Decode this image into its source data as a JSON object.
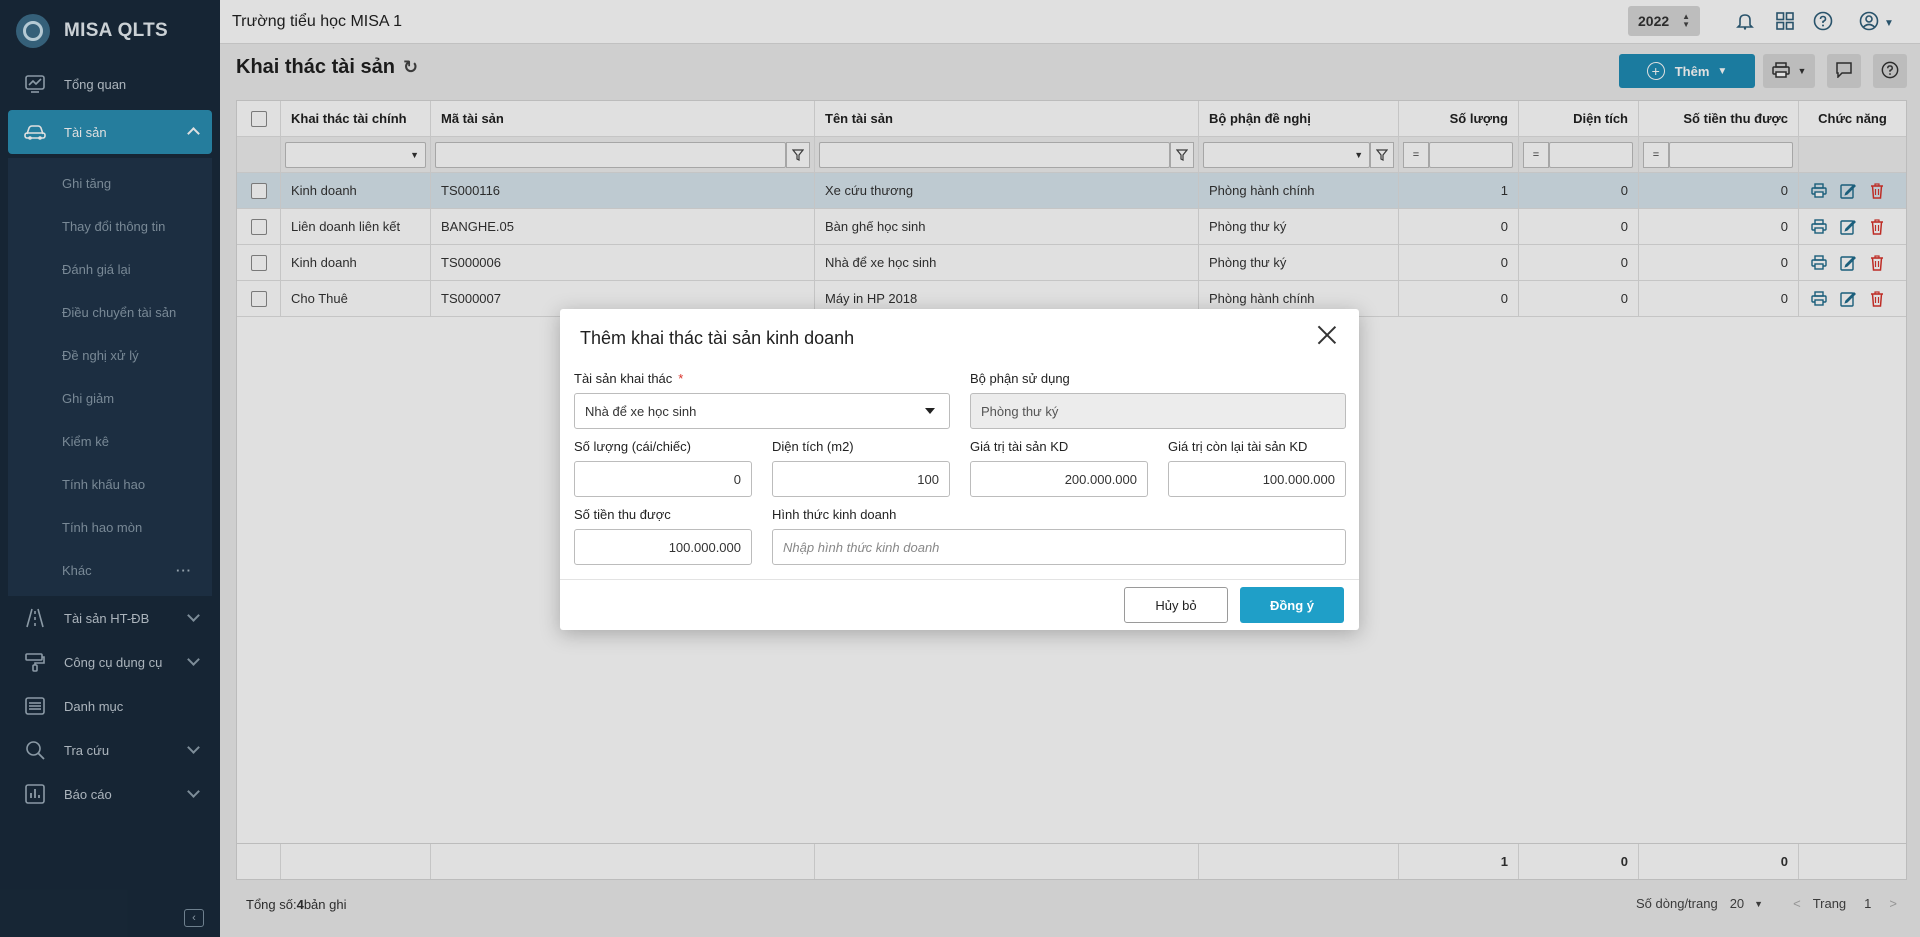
{
  "app": {
    "name": "MISA QLTS"
  },
  "sidebar": {
    "items": [
      {
        "label": "Tổng quan",
        "icon": "dashboard-icon"
      },
      {
        "label": "Tài sản",
        "icon": "car-icon",
        "active": true
      },
      {
        "label": "Tài sản HT-ĐB",
        "icon": "road-icon"
      },
      {
        "label": "Công cụ dụng cụ",
        "icon": "tools-icon"
      },
      {
        "label": "Danh mục",
        "icon": "list-icon"
      },
      {
        "label": "Tra cứu",
        "icon": "search-icon"
      },
      {
        "label": "Báo cáo",
        "icon": "chart-icon"
      }
    ],
    "submenu": [
      "Ghi tăng",
      "Thay đổi thông tin",
      "Đánh giá lại",
      "Điều chuyển tài sản",
      "Đề nghị xử lý",
      "Ghi giảm",
      "Kiểm kê",
      "Tính khấu hao",
      "Tính hao mòn",
      "Khác"
    ],
    "more": "···"
  },
  "topbar": {
    "school": "Trường tiểu học MISA 1",
    "year": "2022"
  },
  "page": {
    "title": "Khai thác tài sản",
    "add_label": "Thêm"
  },
  "grid": {
    "headers": [
      "Khai thác tài chính",
      "Mã tài sản",
      "Tên tài sản",
      "Bộ phận đề nghị",
      "Số lượng",
      "Diện tích",
      "Số tiền thu được",
      "Chức năng"
    ],
    "filter_eq": "=",
    "rows": [
      [
        "Kinh doanh",
        "TS000116",
        "Xe cứu thương",
        "Phòng hành chính",
        "1",
        "0",
        "0"
      ],
      [
        "Liên doanh liên kết",
        "BANGHE.05",
        "Bàn ghế học sinh",
        "Phòng thư ký",
        "0",
        "0",
        "0"
      ],
      [
        "Kinh doanh",
        "TS000006",
        "Nhà để xe học sinh",
        "Phòng thư ký",
        "0",
        "0",
        "0"
      ],
      [
        "Cho Thuê",
        "TS000007",
        "Máy in HP 2018",
        "Phòng hành chính",
        "0",
        "0",
        "0"
      ]
    ],
    "totals": {
      "quantity": "1",
      "area": "0",
      "amount": "0"
    },
    "summary_prefix": "Tổng số: ",
    "summary_count": "4",
    "summary_suffix": " bản ghi",
    "page_size_label": "Số dòng/trang",
    "page_size": "20",
    "page_label": "Trang",
    "page_number": "1"
  },
  "dialog": {
    "title": "Thêm khai thác tài sản kinh doanh",
    "asset_label": "Tài sản khai thác",
    "required_mark": "*",
    "asset_value": "Nhà để xe học sinh",
    "dept_label": "Bộ phận sử dụng",
    "dept_value": "Phòng thư ký",
    "qty_label": "Số lượng (cái/chiếc)",
    "qty_value": "0",
    "area_label": "Diện tích (m2)",
    "area_value": "100",
    "value_label": "Giá trị tài sản KD",
    "value_value": "200.000.000",
    "remain_label": "Giá trị còn lại tài sản KD",
    "remain_value": "100.000.000",
    "amount_label": "Số tiền thu được",
    "amount_value": "100.000.000",
    "form_label": "Hình thức kinh doanh",
    "form_placeholder": "Nhập hình thức kinh doanh",
    "cancel_label": "Hủy bỏ",
    "ok_label": "Đồng ý"
  }
}
